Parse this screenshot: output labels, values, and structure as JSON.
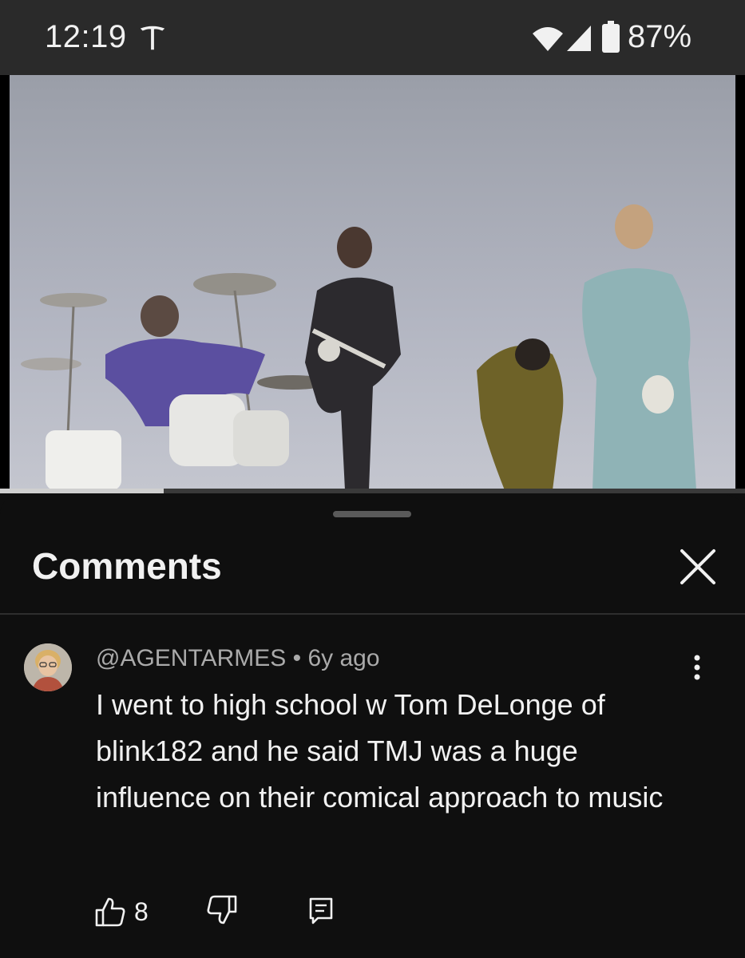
{
  "status_bar": {
    "time": "12:19",
    "battery_percent": "87%",
    "icons": [
      "tesla-icon",
      "wifi-icon",
      "signal-icon",
      "battery-icon"
    ]
  },
  "video": {
    "progress": 0.22,
    "progress_color": "#cfcfcf"
  },
  "comments_sheet": {
    "title": "Comments",
    "close_icon": "close-icon"
  },
  "comment": {
    "author": "@AGENTARMES",
    "separator": "•",
    "age": "6y ago",
    "text": "I went to high school w Tom DeLonge of blink182 and he said TMJ was a huge influence on their comical approach to music",
    "like_count": "8",
    "icons": [
      "thumbs-up-icon",
      "thumbs-down-icon",
      "reply-icon",
      "more-vert-icon"
    ]
  },
  "colors": {
    "background": "#0f0f0f",
    "status_bar": "#2a2a2a",
    "text_primary": "#f1f1f1",
    "text_secondary": "#aaaaaa"
  }
}
